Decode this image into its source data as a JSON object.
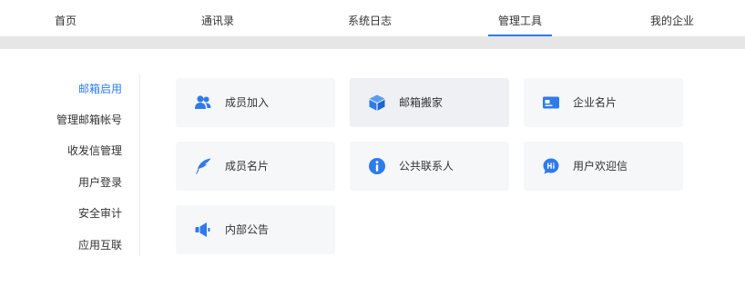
{
  "topnav": {
    "tabs": [
      {
        "label": "首页"
      },
      {
        "label": "通讯录"
      },
      {
        "label": "系统日志"
      },
      {
        "label": "管理工具",
        "active": true
      },
      {
        "label": "我的企业"
      }
    ]
  },
  "sidebar": {
    "items": [
      {
        "label": "邮箱启用",
        "active": true
      },
      {
        "label": "管理邮箱帐号"
      },
      {
        "label": "收发信管理"
      },
      {
        "label": "用户登录"
      },
      {
        "label": "安全审计"
      },
      {
        "label": "应用互联"
      }
    ]
  },
  "tools": [
    {
      "label": "成员加入",
      "icon": "users-icon"
    },
    {
      "label": "邮箱搬家",
      "icon": "box-icon"
    },
    {
      "label": "企业名片",
      "icon": "id-card-icon"
    },
    {
      "label": "成员名片",
      "icon": "feather-icon"
    },
    {
      "label": "公共联系人",
      "icon": "info-icon"
    },
    {
      "label": "用户欢迎信",
      "icon": "hi-chat-icon"
    },
    {
      "label": "内部公告",
      "icon": "megaphone-icon"
    }
  ],
  "colors": {
    "accent": "#2f7bea",
    "card_bg": "#f6f7f9",
    "band": "#e6e6e6"
  }
}
